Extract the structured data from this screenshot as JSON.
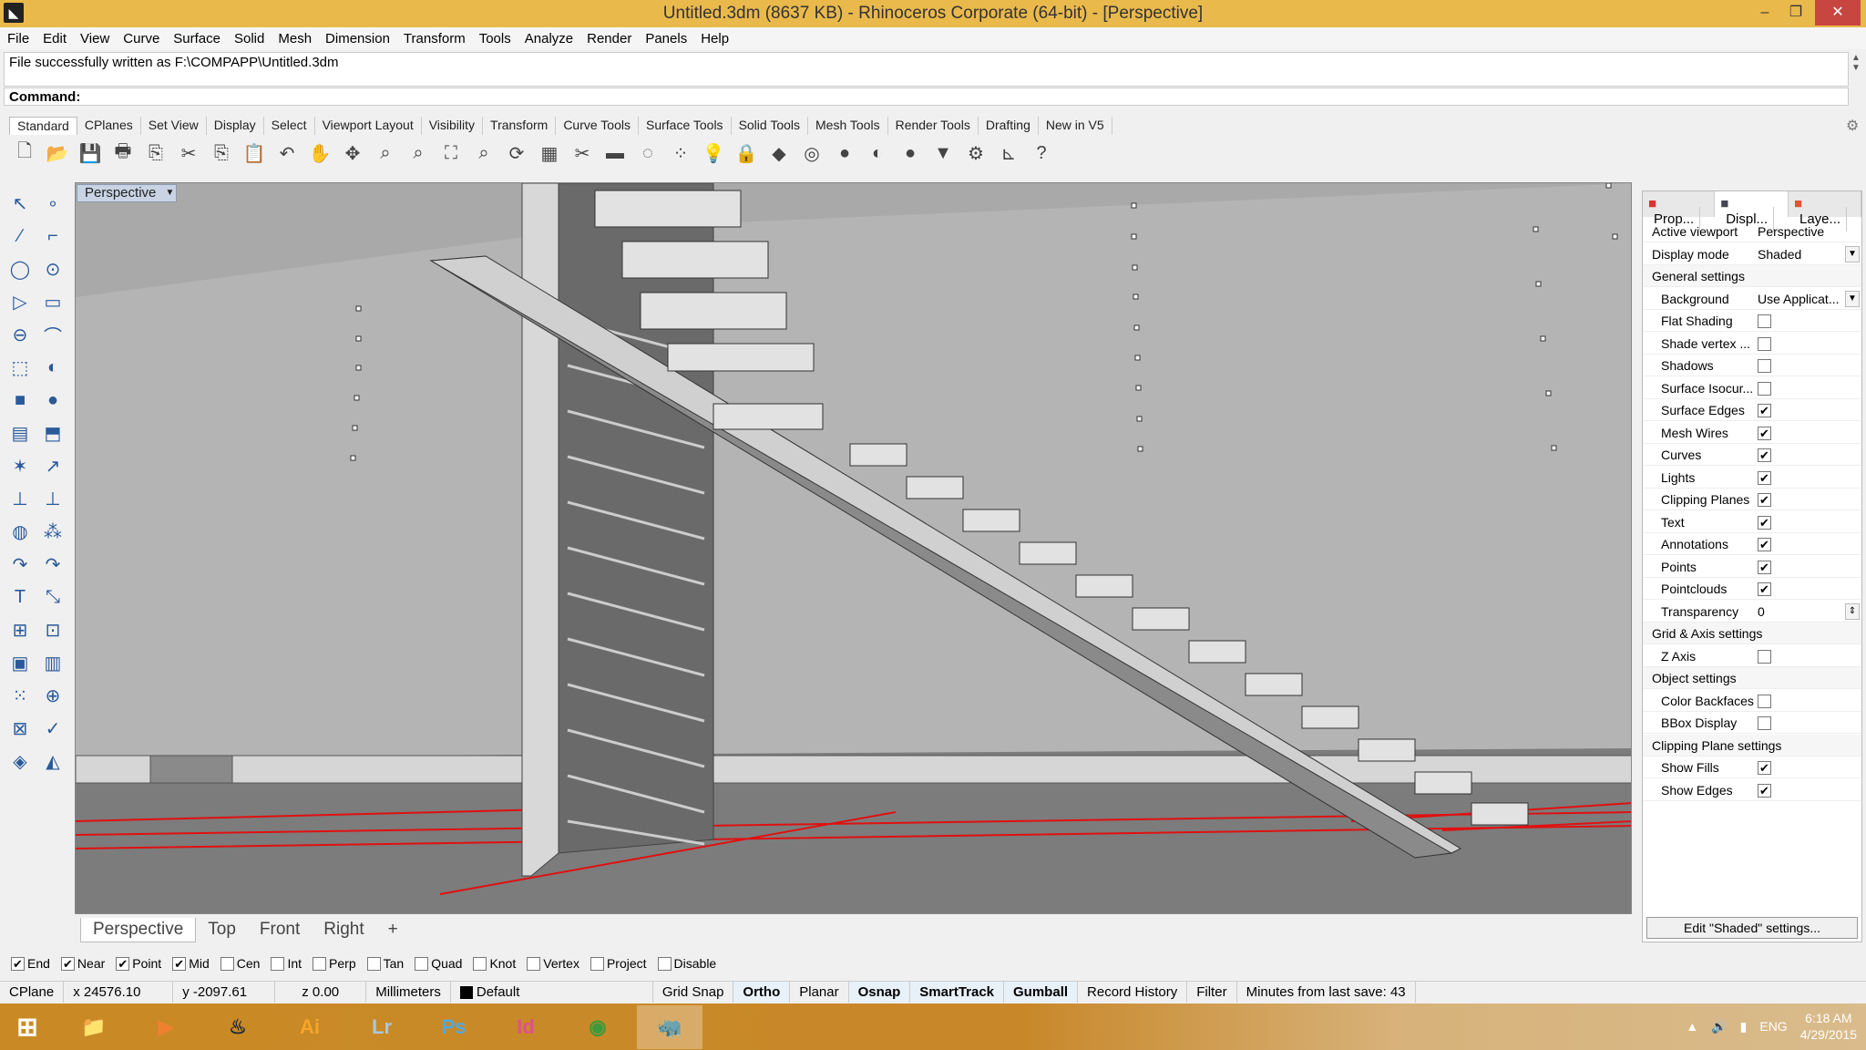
{
  "window": {
    "title": "Untitled.3dm (8637 KB) - Rhinoceros Corporate (64-bit) - [Perspective]"
  },
  "menu": [
    "File",
    "Edit",
    "View",
    "Curve",
    "Surface",
    "Solid",
    "Mesh",
    "Dimension",
    "Transform",
    "Tools",
    "Analyze",
    "Render",
    "Panels",
    "Help"
  ],
  "command": {
    "history": "File successfully written as F:\\COMPAPP\\Untitled.3dm",
    "label": "Command:",
    "value": ""
  },
  "toolbar_tabs": [
    "Standard",
    "CPlanes",
    "Set View",
    "Display",
    "Select",
    "Viewport Layout",
    "Visibility",
    "Transform",
    "Curve Tools",
    "Surface Tools",
    "Solid Tools",
    "Mesh Tools",
    "Render Tools",
    "Drafting",
    "New in V5"
  ],
  "toolbar_icons": [
    "new-file",
    "open",
    "save",
    "print",
    "import",
    "cut",
    "copy",
    "paste",
    "undo",
    "pan",
    "move-view",
    "zoom",
    "zoom-window",
    "zoom-extents",
    "zoom-selected",
    "rotate-view",
    "four-viewports",
    "clipping",
    "grid",
    "circle",
    "points",
    "light",
    "lock",
    "layer",
    "color-wheel",
    "material",
    "render-sphere",
    "shaded-sphere",
    "filter",
    "settings",
    "dimension",
    "help"
  ],
  "viewport": {
    "label": "Perspective",
    "tabs": [
      "Perspective",
      "Top",
      "Front",
      "Right"
    ],
    "add_tab": "+"
  },
  "panel": {
    "tabs": [
      "Prop...",
      "Displ...",
      "Laye..."
    ],
    "rows": [
      {
        "label": "Active viewport",
        "value": "Perspective",
        "type": "text"
      },
      {
        "label": "Display mode",
        "value": "Shaded",
        "type": "dropdown"
      },
      {
        "label": "General settings",
        "type": "section"
      },
      {
        "label": "Background",
        "value": "Use Applicat...",
        "type": "dropdown",
        "sub": true
      },
      {
        "label": "Flat Shading",
        "checked": false,
        "type": "check",
        "sub": true
      },
      {
        "label": "Shade vertex ...",
        "checked": false,
        "type": "check",
        "sub": true
      },
      {
        "label": "Shadows",
        "checked": false,
        "type": "check",
        "sub": true
      },
      {
        "label": "Surface Isocur...",
        "checked": false,
        "type": "check",
        "sub": true
      },
      {
        "label": "Surface Edges",
        "checked": true,
        "type": "check",
        "sub": true
      },
      {
        "label": "Mesh Wires",
        "checked": true,
        "type": "check",
        "sub": true
      },
      {
        "label": "Curves",
        "checked": true,
        "type": "check",
        "sub": true
      },
      {
        "label": "Lights",
        "checked": true,
        "type": "check",
        "sub": true
      },
      {
        "label": "Clipping Planes",
        "checked": true,
        "type": "check",
        "sub": true
      },
      {
        "label": "Text",
        "checked": true,
        "type": "check",
        "sub": true
      },
      {
        "label": "Annotations",
        "checked": true,
        "type": "check",
        "sub": true
      },
      {
        "label": "Points",
        "checked": true,
        "type": "check",
        "sub": true
      },
      {
        "label": "Pointclouds",
        "checked": true,
        "type": "check",
        "sub": true
      },
      {
        "label": "Transparency",
        "value": "0",
        "type": "spinner",
        "sub": true
      },
      {
        "label": "Grid & Axis settings",
        "type": "section"
      },
      {
        "label": "Z Axis",
        "checked": false,
        "type": "check",
        "sub": true
      },
      {
        "label": "Object settings",
        "type": "section"
      },
      {
        "label": "Color Backfaces",
        "checked": false,
        "type": "check",
        "sub": true
      },
      {
        "label": "BBox Display",
        "checked": false,
        "type": "check",
        "sub": true
      },
      {
        "label": "Clipping Plane settings",
        "type": "section"
      },
      {
        "label": "Show Fills",
        "checked": true,
        "type": "check",
        "sub": true
      },
      {
        "label": "Show Edges",
        "checked": true,
        "type": "check",
        "sub": true
      }
    ],
    "edit_button": "Edit \"Shaded\" settings..."
  },
  "osnap": [
    {
      "label": "End",
      "checked": true
    },
    {
      "label": "Near",
      "checked": true
    },
    {
      "label": "Point",
      "checked": true
    },
    {
      "label": "Mid",
      "checked": true
    },
    {
      "label": "Cen",
      "checked": false
    },
    {
      "label": "Int",
      "checked": false
    },
    {
      "label": "Perp",
      "checked": false
    },
    {
      "label": "Tan",
      "checked": false
    },
    {
      "label": "Quad",
      "checked": false
    },
    {
      "label": "Knot",
      "checked": false
    },
    {
      "label": "Vertex",
      "checked": false
    },
    {
      "label": "Project",
      "checked": false
    },
    {
      "label": "Disable",
      "checked": false
    }
  ],
  "status": {
    "cplane": "CPlane",
    "x": "x 24576.10",
    "y": "y -2097.61",
    "z": "z 0.00",
    "units": "Millimeters",
    "layer": "Default",
    "toggles": [
      {
        "label": "Grid Snap",
        "on": false
      },
      {
        "label": "Ortho",
        "on": true
      },
      {
        "label": "Planar",
        "on": false
      },
      {
        "label": "Osnap",
        "on": true
      },
      {
        "label": "SmartTrack",
        "on": true
      },
      {
        "label": "Gumball",
        "on": true
      },
      {
        "label": "Record History",
        "on": false
      },
      {
        "label": "Filter",
        "on": false
      }
    ],
    "save": "Minutes from last save: 43"
  },
  "taskbar": {
    "apps": [
      {
        "name": "file-explorer",
        "label": "",
        "color": "#e8c060"
      },
      {
        "name": "media-player",
        "label": "▶",
        "color": "#f08030"
      },
      {
        "name": "steam",
        "label": "♨",
        "color": "#1b2838"
      },
      {
        "name": "illustrator",
        "label": "Ai",
        "color": "#f7a52a"
      },
      {
        "name": "lightroom",
        "label": "Lr",
        "color": "#a8c8e0"
      },
      {
        "name": "photoshop",
        "label": "Ps",
        "color": "#4fa8e8"
      },
      {
        "name": "indesign",
        "label": "Id",
        "color": "#e0508a"
      },
      {
        "name": "chrome",
        "label": "◉",
        "color": "#3b9a3b"
      },
      {
        "name": "rhino",
        "label": "🦏",
        "color": "#eee"
      }
    ],
    "lang": "ENG",
    "time": "6:18 AM",
    "date": "4/29/2015"
  }
}
